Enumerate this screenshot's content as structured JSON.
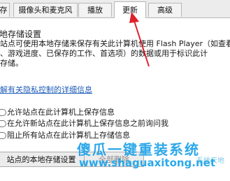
{
  "tabs": [
    {
      "label": "存"
    },
    {
      "label": "摄像头和麦克风"
    },
    {
      "label": "播放"
    },
    {
      "label": "更新"
    },
    {
      "label": "高级"
    }
  ],
  "section_title": "地存储设置",
  "description_lines": [
    "站点可使用本地存储来保存有关此计算机使用 Flash Player（如查看",
    "、游戏进度、已保存的工作、首选项）的数据或用于标识此计",
    "存储。"
  ],
  "privacy_link": "解有关隐私控制的详细信息",
  "radio_options": [
    "允许站点在此计算机上保存信息",
    "在允许新站点在此计算机上保存信息之前询问我",
    "阻止所有站点在此计算机上存储信息"
  ],
  "buttons": {
    "local_storage": "站点的本地存储设置",
    "delete_all": "全部删除"
  },
  "watermark": {
    "text": "傻瓜一键重装系统",
    "url": "www.shaguaxitong.net",
    "badge": "系统天地"
  },
  "colors": {
    "arrow": "#e0202a",
    "link": "#1f5cb8",
    "watermark": "#1da1e8"
  }
}
